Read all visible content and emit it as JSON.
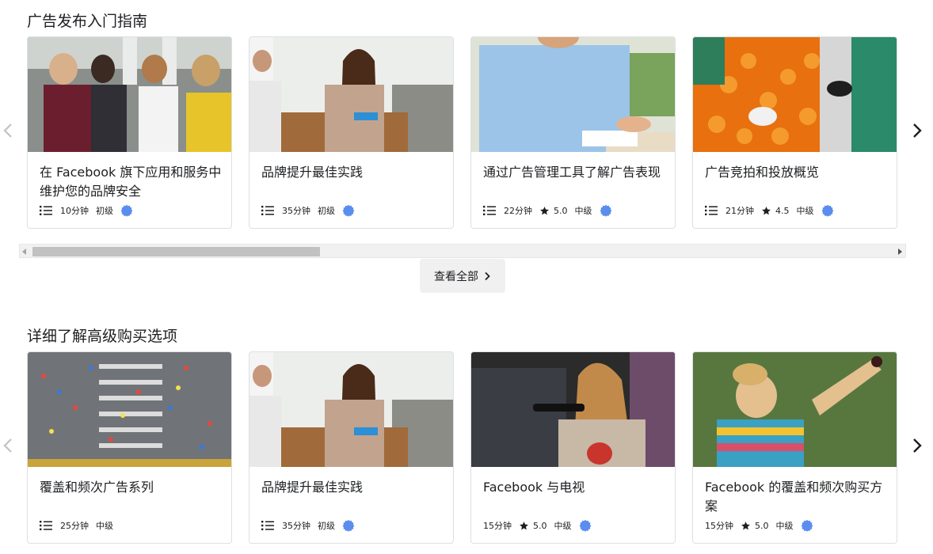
{
  "sections": [
    {
      "title": "广告发布入门指南",
      "cards": [
        {
          "title": "在 Facebook 旗下应用和服务中维护您的品牌安全",
          "duration": "10分钟",
          "rating": "",
          "level": "初级",
          "has_list_icon": true,
          "has_badge": true,
          "image": "people-with-phones"
        },
        {
          "title": "品牌提升最佳实践",
          "duration": "35分钟",
          "rating": "",
          "level": "初级",
          "has_list_icon": true,
          "has_badge": true,
          "image": "woman-with-tablet"
        },
        {
          "title": "通过广告管理工具了解广告表现",
          "duration": "22分钟",
          "rating": "5.0",
          "level": "中级",
          "has_list_icon": true,
          "has_badge": true,
          "image": "man-signing-paper"
        },
        {
          "title": "广告竞拍和投放概览",
          "duration": "21分钟",
          "rating": "4.5",
          "level": "中级",
          "has_list_icon": true,
          "has_badge": true,
          "image": "oranges-market"
        }
      ]
    },
    {
      "title": "详细了解高级购买选项",
      "cards": [
        {
          "title": "覆盖和频次广告系列",
          "duration": "25分钟",
          "rating": "",
          "level": "中级",
          "has_list_icon": true,
          "has_badge": false,
          "image": "runners-crosswalk"
        },
        {
          "title": "品牌提升最佳实践",
          "duration": "35分钟",
          "rating": "",
          "level": "初级",
          "has_list_icon": true,
          "has_badge": true,
          "image": "woman-with-tablet"
        },
        {
          "title": "Facebook 与电视",
          "duration": "15分钟",
          "rating": "5.0",
          "level": "中级",
          "has_list_icon": false,
          "has_badge": true,
          "image": "woman-with-remote"
        },
        {
          "title": "Facebook 的覆盖和频次购买方案",
          "duration": "15分钟",
          "rating": "5.0",
          "level": "中级",
          "has_list_icon": false,
          "has_badge": true,
          "image": "girl-picking-fruit"
        }
      ]
    }
  ],
  "see_all_label": "查看全部",
  "colors": {
    "badge": "#5b8def",
    "border": "#dddfe2",
    "text": "#1c1e21"
  }
}
